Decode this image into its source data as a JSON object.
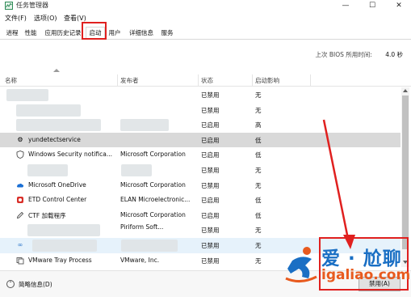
{
  "window": {
    "title": "任务管理器",
    "min_glyph": "—",
    "max_glyph": "☐",
    "close_glyph": "✕"
  },
  "menu": [
    "文件(F)",
    "选项(O)",
    "查看(V)"
  ],
  "tabs": [
    "进程",
    "性能",
    "应用历史记录",
    "启动",
    "用户",
    "详细信息",
    "服务"
  ],
  "active_tab": "启动",
  "bios": {
    "label": "上次 BIOS 所用时间:",
    "value": "4.0 秒"
  },
  "columns": [
    "名称",
    "发布者",
    "状态",
    "启动影响"
  ],
  "rows": [
    {
      "icon": "",
      "name": "",
      "publisher": "",
      "status": "已禁用",
      "impact": "无",
      "obscured": true
    },
    {
      "icon": "",
      "name": "",
      "publisher": "",
      "status": "已禁用",
      "impact": "无",
      "obscured": true
    },
    {
      "icon": "",
      "name": "",
      "publisher": "",
      "status": "已启用",
      "impact": "高",
      "obscured": true
    },
    {
      "icon": "gear-icon",
      "name": "yundetectservice",
      "publisher": "",
      "status": "已启用",
      "impact": "低",
      "selected": true
    },
    {
      "icon": "shield-icon",
      "name": "Windows Security notifica...",
      "publisher": "Microsoft Corporation",
      "status": "已启用",
      "impact": "低"
    },
    {
      "icon": "",
      "name": "",
      "publisher": "",
      "status": "已禁用",
      "impact": "无",
      "obscured": true
    },
    {
      "icon": "cloud-icon",
      "name": "Microsoft OneDrive",
      "publisher": "Microsoft Corporation",
      "status": "已禁用",
      "impact": "无"
    },
    {
      "icon": "etd-icon",
      "name": "ETD Control Center",
      "publisher": "ELAN Microelectronic...",
      "status": "已启用",
      "impact": "低"
    },
    {
      "icon": "pen-icon",
      "name": "CTF 加载程序",
      "publisher": "Microsoft Corporation",
      "status": "已启用",
      "impact": "低"
    },
    {
      "icon": "",
      "name": "",
      "publisher": "Piriform Soft...",
      "status": "已禁用",
      "impact": "无",
      "obscured": true
    },
    {
      "icon": "link-icon",
      "name": "",
      "publisher": "",
      "status": "已禁用",
      "impact": "无",
      "obscured": true,
      "blue": true
    },
    {
      "icon": "vm-icon",
      "name": "VMware Tray Process",
      "publisher": "VMware, Inc.",
      "status": "已禁用",
      "impact": "无"
    }
  ],
  "footer": {
    "fewer_details": "简略信息(D)",
    "disable_button": "禁用(A)"
  },
  "watermark": {
    "cn": "爱 · 尬聊",
    "url": "igaliao.com"
  },
  "colors": {
    "highlight": "#e0201f",
    "selected_row": "#d9d9d9",
    "watermark_blue": "#1a6fc4",
    "watermark_orange": "#e85a1e"
  }
}
